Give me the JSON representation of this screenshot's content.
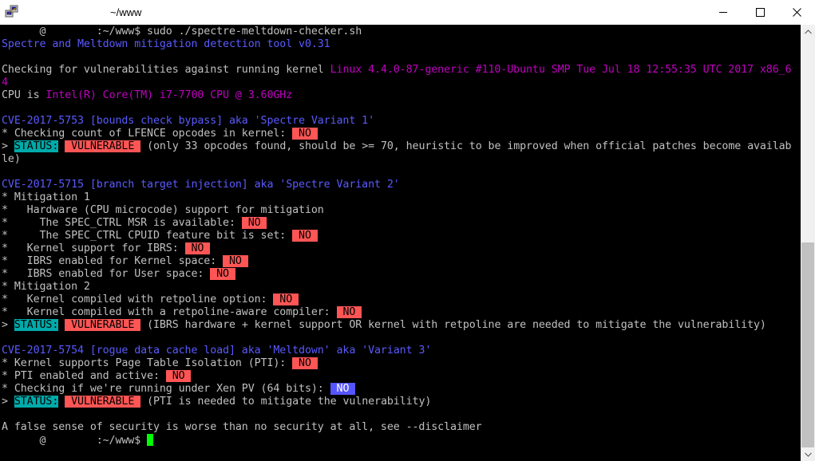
{
  "window": {
    "title": "~/www"
  },
  "icons": {
    "app": "putty-icon",
    "minimize": "minimize-icon",
    "maximize": "maximize-icon",
    "close": "close-icon"
  },
  "colors": {
    "blue_text": "#5a5aff",
    "magenta_text": "#c000c0",
    "red_badge": "#ff5555",
    "cyan_badge": "#00aaaa",
    "blue_badge": "#5555ff",
    "cursor": "#00ff00"
  },
  "terminal": {
    "l01": {
      "a": "      @        :~/www$ sudo ./spectre-meltdown-checker.sh"
    },
    "l02": {
      "a": "Spectre and Meltdown mitigation detection tool v0.31"
    },
    "l04": {
      "a": "Checking for vulnerabilities against running kernel ",
      "b": "Linux 4.4.0-87-generic #110-Ubuntu SMP Tue Jul 18 12:55:35 UTC 2017 x86_6"
    },
    "l05": {
      "a": "4"
    },
    "l06": {
      "a": "CPU is ",
      "b": "Intel(R) Core(TM) i7-7700 CPU @ 3.60GHz"
    },
    "l08": {
      "a": "CVE-2017-5753 [bounds check bypass] aka 'Spectre Variant 1'"
    },
    "l09": {
      "a": "* Checking count of LFENCE opcodes in kernel: ",
      "badge": " NO "
    },
    "l10": {
      "a": "> ",
      "status": "STATUS:",
      "sp": " ",
      "badge": " VULNERABLE ",
      "b": " (only 33 opcodes found, should be >= 70, heuristic to be improved when official patches become availab"
    },
    "l11": {
      "a": "le)"
    },
    "l13": {
      "a": "CVE-2017-5715 [branch target injection] aka 'Spectre Variant 2'"
    },
    "l14": {
      "a": "* Mitigation 1"
    },
    "l15": {
      "a": "*   Hardware (CPU microcode) support for mitigation"
    },
    "l16": {
      "a": "*     The SPEC_CTRL MSR is available: ",
      "badge": " NO "
    },
    "l17": {
      "a": "*     The SPEC_CTRL CPUID feature bit is set: ",
      "badge": " NO "
    },
    "l18": {
      "a": "*   Kernel support for IBRS: ",
      "badge": " NO "
    },
    "l19": {
      "a": "*   IBRS enabled for Kernel space: ",
      "badge": " NO "
    },
    "l20": {
      "a": "*   IBRS enabled for User space: ",
      "badge": " NO "
    },
    "l21": {
      "a": "* Mitigation 2"
    },
    "l22": {
      "a": "*   Kernel compiled with retpoline option: ",
      "badge": " NO "
    },
    "l23": {
      "a": "*   Kernel compiled with a retpoline-aware compiler: ",
      "badge": " NO "
    },
    "l24": {
      "a": "> ",
      "status": "STATUS:",
      "sp": " ",
      "badge": " VULNERABLE ",
      "b": " (IBRS hardware + kernel support OR kernel with retpoline are needed to mitigate the vulnerability)"
    },
    "l26": {
      "a": "CVE-2017-5754 [rogue data cache load] aka 'Meltdown' aka 'Variant 3'"
    },
    "l27": {
      "a": "* Kernel supports Page Table Isolation (PTI): ",
      "badge": " NO "
    },
    "l28": {
      "a": "* PTI enabled and active: ",
      "badge": " NO "
    },
    "l29": {
      "a": "* Checking if we're running under Xen PV (64 bits): ",
      "badge": " NO "
    },
    "l30": {
      "a": "> ",
      "status": "STATUS:",
      "sp": " ",
      "badge": " VULNERABLE ",
      "b": " (PTI is needed to mitigate the vulnerability)"
    },
    "l32": {
      "a": "A false sense of security is worse than no security at all, see --disclaimer"
    },
    "l33": {
      "a": "      @        :~/www$ "
    }
  }
}
